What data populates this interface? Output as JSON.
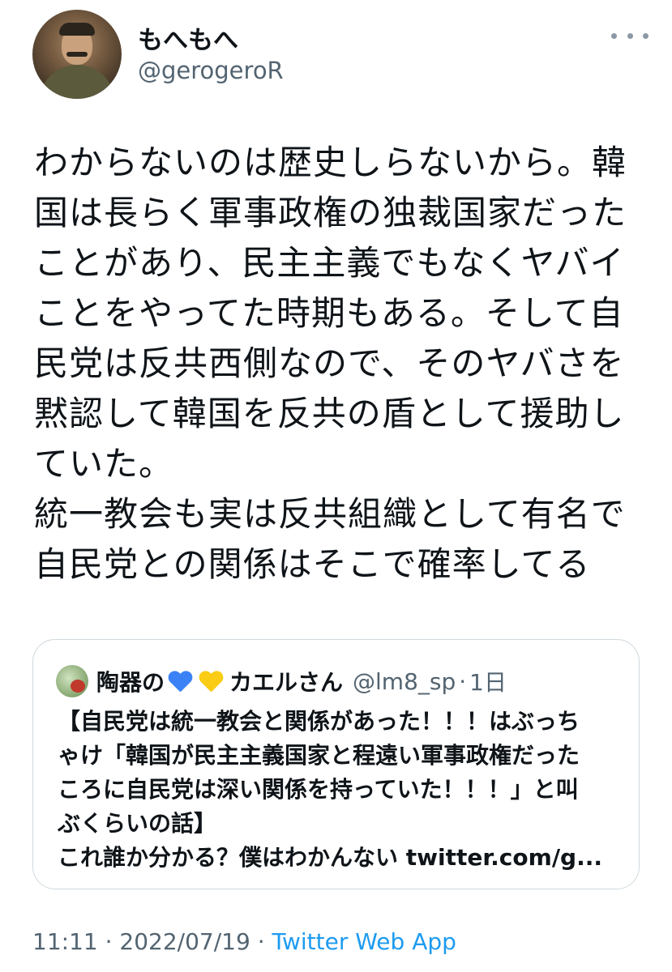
{
  "author": {
    "display_name": "もへもへ",
    "handle": "@gerogeroR"
  },
  "tweet": {
    "lines": [
      "わからないのは歴史しらないから。韓",
      "国は長らく軍事政権の独裁国家だった",
      "ことがあり、民主主義でもなくヤバイ",
      "ことをやってた時期もある。そして自",
      "民党は反共西側なので、そのヤバさを",
      "黙認して韓国を反共の盾として援助し",
      "ていた。",
      "統一教会も実は反共組織として有名で",
      "自民党との関係はそこで確率してる"
    ]
  },
  "quote": {
    "name_part1": "陶器の",
    "name_part2": "カエルさん",
    "hearts": [
      "blue-heart-icon",
      "yellow-heart-icon"
    ],
    "handle": "@lm8_sp",
    "separator": "·",
    "time": "1日",
    "lines": [
      "【自民党は統一教会と関係があった！！！はぶっち",
      "ゃけ「韓国が民主主義国家と程遠い軍事政権だった",
      "ころに自民党は深い関係を持っていた！！！」と叫",
      "ぶくらいの話】",
      "これ誰か分かる？僕はわかんない twitter.com/g..."
    ]
  },
  "meta": {
    "time": "11:11",
    "sep1": " · ",
    "date": "2022/07/19",
    "sep2": " · ",
    "source": "Twitter Web App"
  },
  "colors": {
    "text": "#0f1419",
    "secondary": "#536471",
    "link": "#1d9bf0",
    "border": "#cfd9de"
  }
}
